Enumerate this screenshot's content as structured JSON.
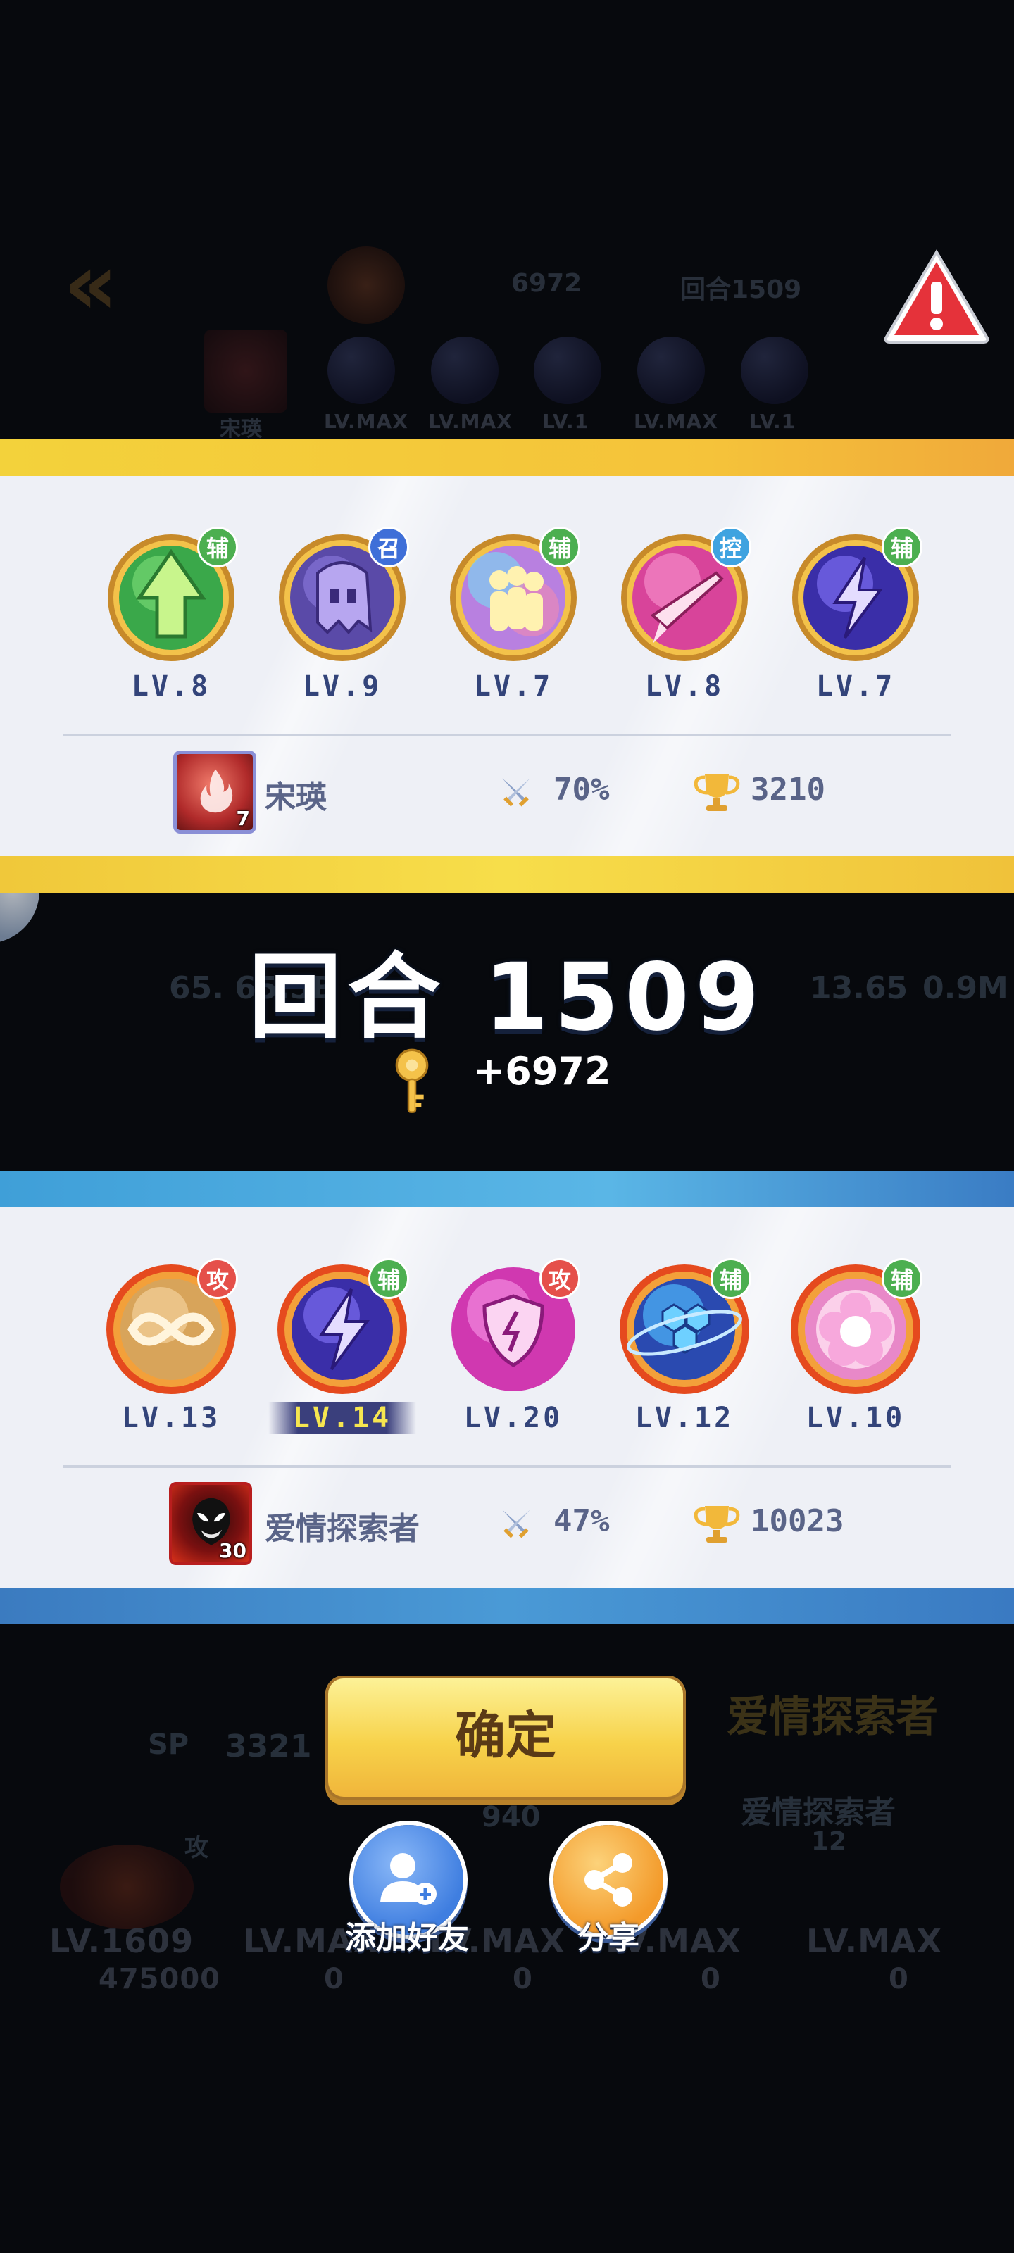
{
  "background": {
    "top_key_count": "6972",
    "top_round": "回合1509",
    "top_avatar_name": "宋瑛",
    "top_skill_levels": [
      "LV.MAX",
      "LV.MAX",
      "LV.1",
      "LV.MAX",
      "LV.1"
    ],
    "mid_left_values": "65.  65.5B",
    "mid_right_value": "13.65",
    "mid_right_value2": "0.9M",
    "sp_value": "3321",
    "sub_count": "940",
    "opponent_name": "爱情探索者",
    "opponent_level": "12",
    "bottom_levels": [
      "LV.1609",
      "LV.MAX",
      "LV.MAX",
      "LV.MAX",
      "LV.MAX"
    ],
    "bottom_sp_values": [
      "475000",
      "0",
      "0",
      "0",
      "0"
    ],
    "sp_label": "SP",
    "skill_tag_attack": "攻"
  },
  "top_panel": {
    "skills": [
      {
        "tag": "辅",
        "tag_color": "#4caf50",
        "level": "LV.8",
        "icon": "green-arrow-orb-icon"
      },
      {
        "tag": "召",
        "tag_color": "#3f6fd8",
        "level": "LV.9",
        "icon": "purple-ghost-orb-icon"
      },
      {
        "tag": "辅",
        "tag_color": "#4caf50",
        "level": "LV.7",
        "icon": "rainbow-figures-orb-icon"
      },
      {
        "tag": "控",
        "tag_color": "#3fa3e0",
        "level": "LV.8",
        "icon": "pink-dagger-orb-icon"
      },
      {
        "tag": "辅",
        "tag_color": "#4caf50",
        "level": "LV.7",
        "icon": "lightning-orb-icon"
      }
    ],
    "player": {
      "name": "宋瑛",
      "avatar_level": "7",
      "win_rate": "70%",
      "trophies": "3210"
    }
  },
  "round": {
    "title": "回合 1509",
    "key_reward": "+6972"
  },
  "bottom_panel": {
    "skills": [
      {
        "tag": "攻",
        "tag_color": "#e5504a",
        "level": "LV.13",
        "icon": "infinity-fire-orb-icon"
      },
      {
        "tag": "辅",
        "tag_color": "#4caf50",
        "level": "LV.14",
        "icon": "lightning-fire-orb-icon",
        "highlight": true
      },
      {
        "tag": "攻",
        "tag_color": "#e5504a",
        "level": "LV.20",
        "icon": "pink-shield-orb-icon"
      },
      {
        "tag": "辅",
        "tag_color": "#4caf50",
        "level": "LV.12",
        "icon": "hexagon-planet-orb-icon"
      },
      {
        "tag": "辅",
        "tag_color": "#4caf50",
        "level": "LV.10",
        "icon": "pink-flower-orb-icon"
      }
    ],
    "player": {
      "name": "爱情探索者",
      "avatar_level": "30",
      "win_rate": "47%",
      "trophies": "10023"
    }
  },
  "actions": {
    "confirm_label": "确定",
    "add_friend_label": "添加好友",
    "share_label": "分享"
  }
}
